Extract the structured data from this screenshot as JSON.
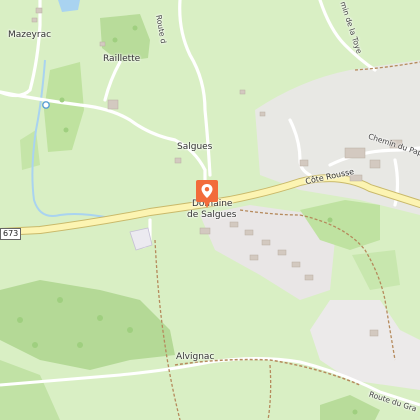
{
  "map": {
    "places": {
      "mazeyrac": "Mazeyrac",
      "raillette": "Raillette",
      "salgues": "Salgues",
      "domaine_line1": "Domaine",
      "domaine_line2": "de Salgues",
      "alvignac": "Alvignac"
    },
    "roads": {
      "cote_rousse": "Côte Rousse",
      "chemin_du_pape": "Chemin du Pape",
      "route_top_left": "Route d",
      "route_top_right": "min de la Toye",
      "route_du_gra": "Route du Gra",
      "road_number": "673"
    },
    "marker": {
      "icon": "map-pin-icon",
      "color": "#f26b3a"
    },
    "colors": {
      "meadow": "#d9efc4",
      "forest": "#c7e6a8",
      "residential": "#e3e3e3",
      "main_road": "#fcf4b2",
      "water": "#a9d3f0",
      "path": "#b58a5c"
    }
  }
}
